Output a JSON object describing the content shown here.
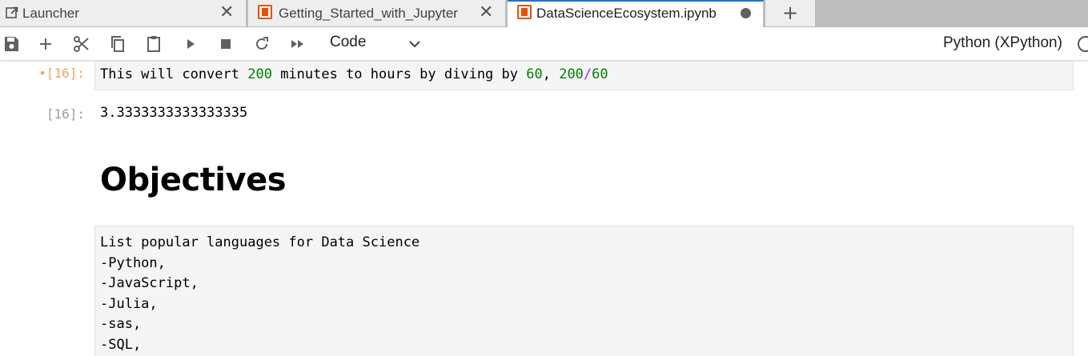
{
  "tabs": [
    {
      "label": "Launcher",
      "icon": "launcher-icon"
    },
    {
      "label": "Getting_Started_with_Jupyter",
      "icon": "notebook-icon"
    },
    {
      "label": "DataScienceEcosystem.ipynb",
      "icon": "notebook-icon",
      "active": true,
      "unsaved": true
    }
  ],
  "toolbar": {
    "cell_type": "Code",
    "kernel": "Python (XPython)",
    "icons": [
      "save-icon",
      "add-cell-icon",
      "cut-icon",
      "copy-icon",
      "paste-icon",
      "run-icon",
      "stop-icon",
      "restart-icon",
      "fast-forward-icon"
    ]
  },
  "cells": {
    "code": {
      "prompt": "[16]:",
      "dirty_marker": "•",
      "text": {
        "p1": "This will convert ",
        "n1": "200",
        "p2": " minutes to hours by diving by ",
        "n2": "60",
        "p3": ", ",
        "n3": "200",
        "op": "/",
        "n4": "60"
      }
    },
    "output": {
      "prompt": "[16]:",
      "value": "3.3333333333333335"
    },
    "heading": "Objectives",
    "markdown_lines": [
      "List popular languages for Data Science",
      "-Python,",
      "-JavaScript,",
      "-Julia,",
      "-sas,",
      "-SQL,"
    ]
  },
  "colors": {
    "accent": "#1976d2",
    "notebook_icon": "#e65100",
    "dirty_prompt": "#f4a261",
    "number": "#008000",
    "operator": "#aa22ff"
  }
}
